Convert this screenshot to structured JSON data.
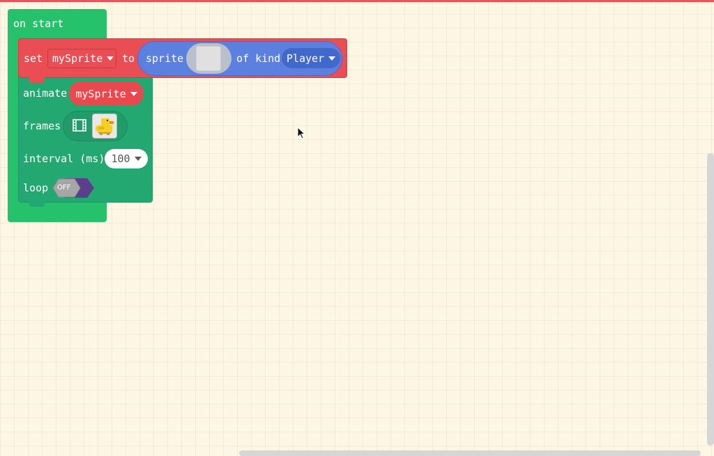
{
  "hat": {
    "label": "on start"
  },
  "set_block": {
    "keyword": "set",
    "variable": "mySprite",
    "to": "to",
    "sprite_label": "sprite",
    "of_kind": "of kind",
    "kind_value": "Player"
  },
  "animate_block": {
    "keyword": "animate",
    "variable": "mySprite",
    "frames_label": "frames",
    "interval_label": "interval (ms)",
    "interval_value": "100",
    "loop_label": "loop",
    "loop_value": "OFF"
  },
  "colors": {
    "hat": "#25c26b",
    "set_block": "#ea4e54",
    "sprite_block": "#5b80e0",
    "animate_block": "#24a872",
    "toggle": "#5b3f8c",
    "background": "#fdf6e3"
  },
  "icons": {
    "dropdown": "caret-down-icon",
    "frames": "film-strip-icon",
    "sprite_image": "duck-sprite-icon",
    "cursor": "mouse-pointer-icon"
  }
}
